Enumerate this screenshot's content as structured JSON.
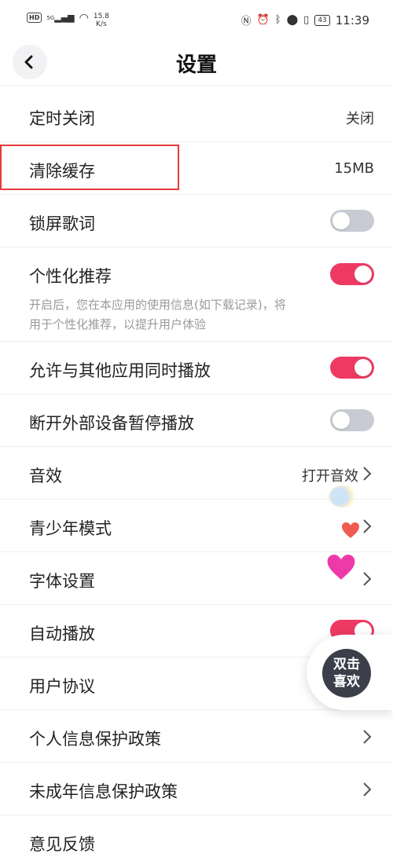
{
  "status": {
    "hd": "HD",
    "signal": "5G",
    "speed_value": "15.8",
    "speed_unit": "K/s",
    "battery": "43",
    "time": "11:39"
  },
  "header": {
    "title": "设置"
  },
  "rows": [
    {
      "label": "定时关闭",
      "value": "关闭"
    },
    {
      "label": "清除缓存",
      "value": "15MB"
    },
    {
      "label": "锁屏歌词",
      "toggle": "off"
    },
    {
      "label": "个性化推荐",
      "toggle": "on",
      "desc": "开启后，您在本应用的使用信息(如下载记录)，将用于个性化推荐，以提升用户体验"
    },
    {
      "label": "允许与其他应用同时播放",
      "toggle": "on"
    },
    {
      "label": "断开外部设备暂停播放",
      "toggle": "off"
    },
    {
      "label": "音效",
      "value": "打开音效"
    },
    {
      "label": "青少年模式"
    },
    {
      "label": "字体设置"
    },
    {
      "label": "自动播放",
      "toggle": "on"
    },
    {
      "label": "用户协议"
    },
    {
      "label": "个人信息保护政策"
    },
    {
      "label": "未成年信息保护政策"
    },
    {
      "label": "意见反馈"
    }
  ],
  "floating": {
    "line1": "双击",
    "line2": "喜欢"
  },
  "colors": {
    "accent": "#ee3a63",
    "toggle_off": "#c9cbd4",
    "highlight": "#e53a3a"
  }
}
